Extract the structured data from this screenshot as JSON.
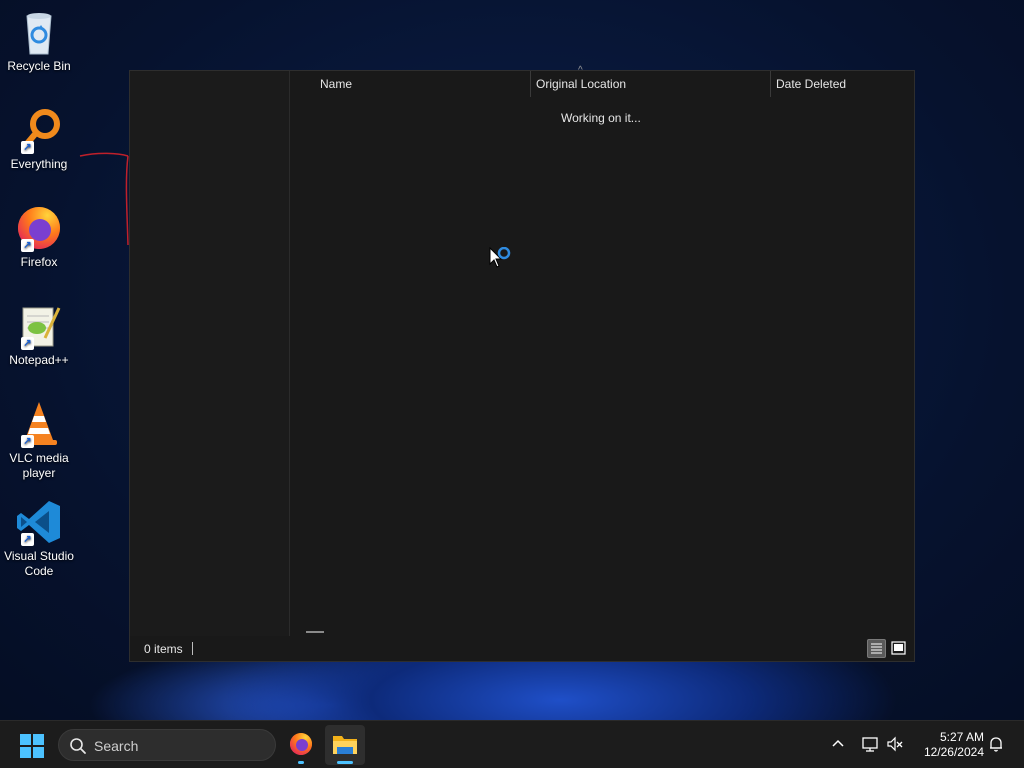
{
  "desktop": {
    "icons": [
      {
        "label": "Recycle Bin",
        "icon": "recycle-bin-icon"
      },
      {
        "label": "Everything",
        "icon": "everything-search-icon"
      },
      {
        "label": "Firefox",
        "icon": "firefox-icon"
      },
      {
        "label": "Notepad++",
        "icon": "notepad-plus-plus-icon"
      },
      {
        "label": "VLC media player",
        "icon": "vlc-icon"
      },
      {
        "label": "Visual Studio Code",
        "icon": "vscode-icon"
      }
    ]
  },
  "window": {
    "columns": {
      "name": "Name",
      "original_location": "Original Location",
      "date_deleted": "Date Deleted"
    },
    "sort_indicator": "^",
    "loading_text": "Working on it...",
    "status_text": "0 items"
  },
  "taskbar": {
    "search_label": "Search",
    "apps": [
      "firefox-icon",
      "file-explorer-icon"
    ],
    "time": "5:27 AM",
    "date": "12/26/2024"
  },
  "colors": {
    "accent": "#4cc2ff",
    "window_bg": "#191919",
    "taskbar_bg": "#1c1c1c"
  }
}
